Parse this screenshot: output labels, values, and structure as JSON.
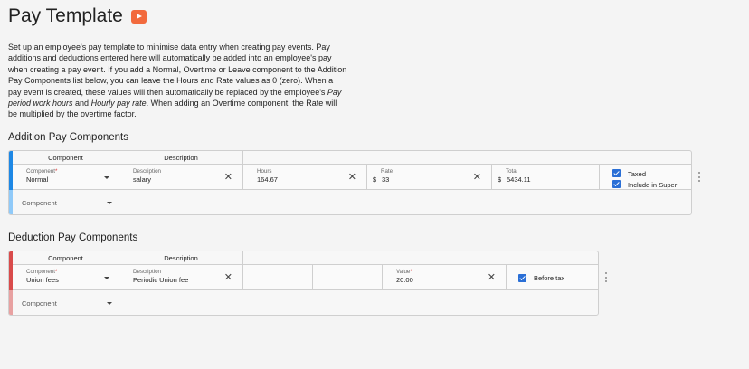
{
  "page": {
    "title": "Pay Template",
    "intro_parts": [
      "Set up an employee's pay template to minimise data entry when creating pay events. Pay additions and deductions entered here will automatically be added into an employee's pay when creating a pay event. If you add a Normal, Overtime or Leave component to the Addition Pay Components list below, you can leave the Hours and Rate values as 0 (zero). When a pay event is created, these values will then automatically be replaced by the employee's ",
      "Pay period work hours",
      " and ",
      "Hourly pay rate",
      ". When adding an Overtime component, the Rate will be multiplied by the overtime factor."
    ]
  },
  "additions": {
    "title": "Addition Pay Components",
    "accent_color": "#1e88e5",
    "accent_color_light": "#90caf9",
    "headers": {
      "component": "Component",
      "description": "Description"
    },
    "row": {
      "component_label": "Component",
      "component_value": "Normal",
      "description_label": "Description",
      "description_value": "salary",
      "hours_label": "Hours",
      "hours_value": "164.67",
      "rate_label": "Rate",
      "rate_currency": "$",
      "rate_value": "33",
      "total_label": "Total",
      "total_currency": "$",
      "total_value": "5434.11",
      "taxed_label": "Taxed",
      "taxed_checked": true,
      "super_label": "Include in Super",
      "super_checked": true
    },
    "new_row_label": "Component"
  },
  "deductions": {
    "title": "Deduction Pay Components",
    "accent_color": "#d94b4b",
    "accent_color_light": "#e8a1a1",
    "headers": {
      "component": "Component",
      "description": "Description"
    },
    "row": {
      "component_label": "Component",
      "component_value": "Union fees",
      "description_label": "Description",
      "description_value": "Periodic Union fee",
      "value_label": "Value",
      "value_value": "20.00",
      "before_tax_label": "Before tax",
      "before_tax_checked": true
    },
    "new_row_label": "Component"
  }
}
